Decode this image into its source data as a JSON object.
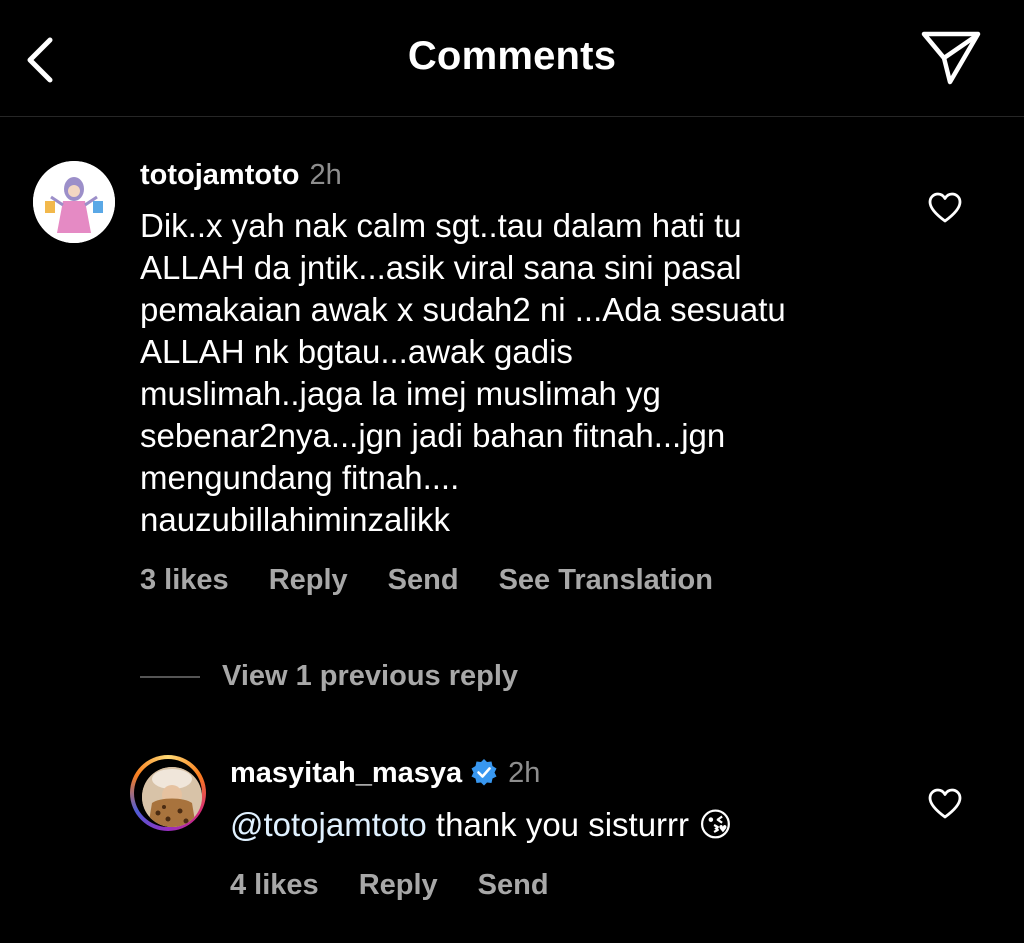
{
  "header": {
    "title": "Comments",
    "back_icon": "chevron-left-icon",
    "send_icon": "paper-plane-icon"
  },
  "comments": [
    {
      "username": "totojamtoto",
      "time": "2h",
      "lines": [
        "Dik..x yah nak calm sgt..tau dalam hati tu",
        "ALLAH da jntik...asik viral sana sini pasal",
        "pemakaian awak x sudah2 ni ...Ada sesuatu",
        "ALLAH nk bgtau...awak gadis",
        "muslimah..jaga la imej muslimah yg",
        "sebenar2nya...jgn jadi bahan fitnah...jgn",
        "mengundang fitnah....",
        "nauzubillahiminzalikk"
      ],
      "likes": "3 likes",
      "reply_label": "Reply",
      "send_label": "Send",
      "translation_label": "See Translation"
    }
  ],
  "view_replies": "View 1 previous reply",
  "reply": {
    "username": "masyitah_masya",
    "verified": true,
    "time": "2h",
    "mention": "@totojamtoto",
    "text": " thank you sisturrr ",
    "emoji": "😘",
    "likes": "4 likes",
    "reply_label": "Reply",
    "send_label": "Send"
  },
  "colors": {
    "background": "#000000",
    "secondary_text": "#a8a8a8",
    "verified_blue": "#3897f0"
  }
}
